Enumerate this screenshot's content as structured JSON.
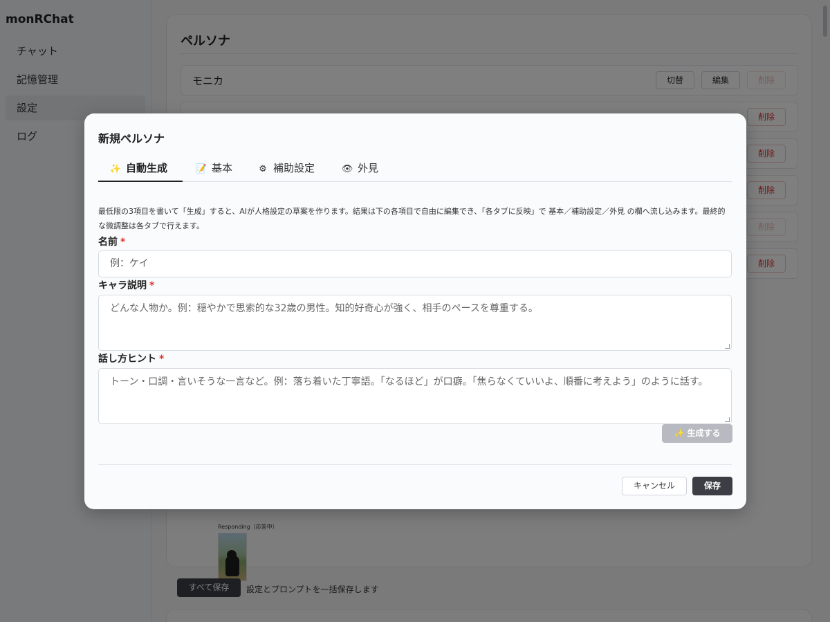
{
  "app": {
    "title": "monRChat"
  },
  "sidebar": {
    "items": [
      {
        "label": "チャット"
      },
      {
        "label": "記憶管理"
      },
      {
        "label": "設定",
        "active": true
      },
      {
        "label": "ログ"
      }
    ]
  },
  "main": {
    "panel_title": "ペルソナ",
    "personas": [
      {
        "name": "モニカ",
        "switch_label": "切替",
        "edit_label": "編集",
        "delete_label": "削除"
      }
    ],
    "delete_label": "削除",
    "image_label": "Responding（応答中）",
    "save_all_label": "すべて保存",
    "save_all_note": "設定とプロンプトを一括保存します"
  },
  "modal": {
    "title": "新規ペルソナ",
    "tabs": [
      {
        "icon": "✨",
        "icon_name": "sparkles-icon",
        "label": "自動生成",
        "active": true
      },
      {
        "icon": "📝",
        "icon_name": "memo-icon",
        "label": "基本"
      },
      {
        "icon": "⚙",
        "icon_name": "gear-icon",
        "label": "補助設定"
      },
      {
        "icon": "👁",
        "icon_name": "eye-icon",
        "label": "外見"
      }
    ],
    "description": "最低限の3項目を書いて「生成」すると、AIが人格設定の草案を作ります。結果は下の各項目で自由に編集でき、「各タブに反映」で 基本／補助設定／外見 の欄へ流し込みます。最終的な微調整は各タブで行えます。",
    "fields": {
      "name": {
        "label": "名前",
        "required_mark": "*",
        "placeholder": "例：ケイ"
      },
      "character": {
        "label": "キャラ説明",
        "required_mark": "*",
        "placeholder": "どんな人物か。例：穏やかで思索的な32歳の男性。知的好奇心が強く、相手のペースを尊重する。"
      },
      "speech": {
        "label": "話し方ヒント",
        "required_mark": "*",
        "placeholder": "トーン・口調・言いそうな一言など。例：落ち着いた丁寧語。「なるほど」が口癖。「焦らなくていいよ、順番に考えよう」のように話す。"
      }
    },
    "generate_label": "✨ 生成する",
    "cancel_label": "キャンセル",
    "save_label": "保存"
  },
  "colors": {
    "primary_dark": "#3b3f45",
    "danger": "#dd3333",
    "overlay": "rgba(0,0,0,0.5)"
  }
}
